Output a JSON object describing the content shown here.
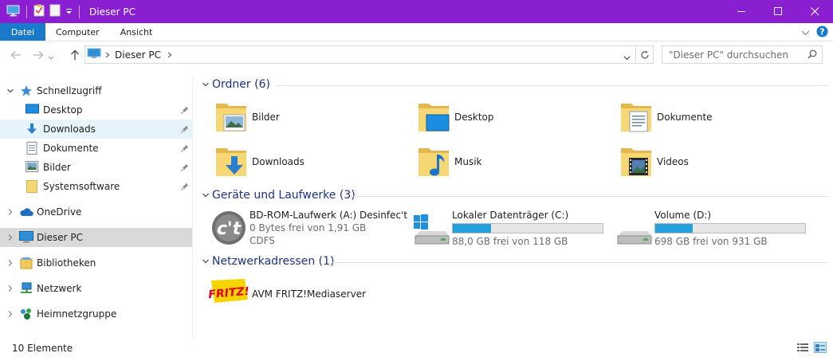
{
  "window": {
    "title": "Dieser PC",
    "accent": "#8a1fd2"
  },
  "ribbon": {
    "tabs": [
      "Datei",
      "Computer",
      "Ansicht"
    ]
  },
  "address": {
    "path_label": "Dieser PC",
    "search_placeholder": "\"Dieser PC\" durchsuchen"
  },
  "sidebar": {
    "quick_access": "Schnellzugriff",
    "pinned": [
      {
        "label": "Desktop",
        "icon": "desktop-icon"
      },
      {
        "label": "Downloads",
        "icon": "downloads-icon"
      },
      {
        "label": "Dokumente",
        "icon": "documents-icon"
      },
      {
        "label": "Bilder",
        "icon": "pictures-icon"
      },
      {
        "label": "Systemsoftware",
        "icon": "folder-icon"
      }
    ],
    "onedrive": "OneDrive",
    "this_pc": "Dieser PC",
    "libraries": "Bibliotheken",
    "network": "Netzwerk",
    "homegroup": "Heimnetzgruppe"
  },
  "groups": {
    "folders": "Ordner (6)",
    "devices": "Geräte und Laufwerke (3)",
    "network": "Netzwerkadressen (1)"
  },
  "folders": [
    {
      "label": "Bilder",
      "icon": "pictures-folder-icon"
    },
    {
      "label": "Desktop",
      "icon": "desktop-folder-icon"
    },
    {
      "label": "Dokumente",
      "icon": "documents-folder-icon"
    },
    {
      "label": "Downloads",
      "icon": "downloads-folder-icon"
    },
    {
      "label": "Musik",
      "icon": "music-folder-icon"
    },
    {
      "label": "Videos",
      "icon": "videos-folder-icon"
    }
  ],
  "drives": [
    {
      "name": "BD-ROM-Laufwerk (A:) Desinfec't",
      "free": "0 Bytes frei von 1,91 GB",
      "fs": "CDFS",
      "icon": "disc-drive-icon"
    },
    {
      "name": "Lokaler Datenträger (C:)",
      "free": "88,0 GB frei von 118 GB",
      "used_fraction": 0.254,
      "icon": "windows-drive-icon"
    },
    {
      "name": "Volume (D:)",
      "free": "698 GB frei von 931 GB",
      "used_fraction": 0.25,
      "icon": "hard-drive-icon"
    }
  ],
  "network_locations": [
    {
      "name": "AVM FRITZ!Mediaserver",
      "icon": "fritz-logo-icon"
    }
  ],
  "status": {
    "count": "10 Elemente"
  }
}
